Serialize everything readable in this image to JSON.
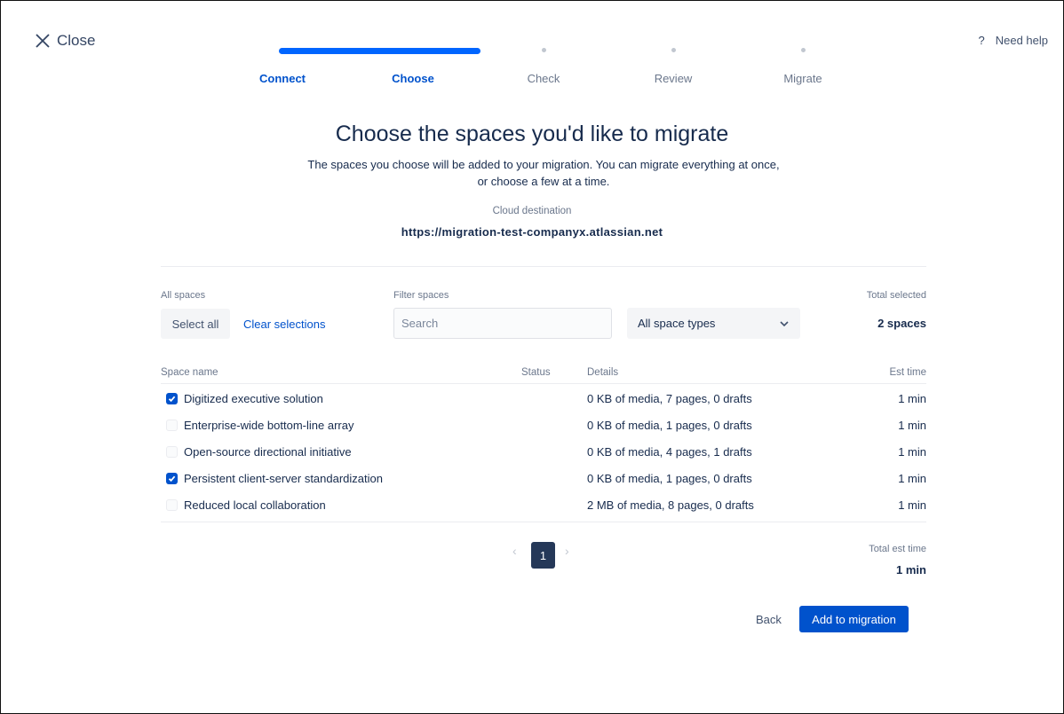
{
  "topbar": {
    "close_label": "Close",
    "help_label": "Need help",
    "help_icon": "?"
  },
  "steps": [
    {
      "label": "Connect",
      "state": "done"
    },
    {
      "label": "Choose",
      "state": "current"
    },
    {
      "label": "Check",
      "state": "todo"
    },
    {
      "label": "Review",
      "state": "todo"
    },
    {
      "label": "Migrate",
      "state": "todo"
    }
  ],
  "header": {
    "title": "Choose the spaces you'd like to migrate",
    "subtitle_line1": "The spaces you choose will be added to your migration. You can migrate everything at once,",
    "subtitle_line2": "or choose a few at a time.",
    "dest_label": "Cloud destination",
    "dest_url": "https://migration-test-companyx.atlassian.net"
  },
  "controls": {
    "all_spaces_label": "All spaces",
    "select_all": "Select all",
    "clear_selections": "Clear selections",
    "filter_label": "Filter spaces",
    "search_placeholder": "Search",
    "space_type_selected": "All space types",
    "total_selected_label": "Total selected",
    "total_selected_value": "2 spaces"
  },
  "table": {
    "headers": {
      "name": "Space name",
      "status": "Status",
      "details": "Details",
      "est": "Est time"
    },
    "rows": [
      {
        "name": "Digitized executive solution",
        "checked": true,
        "details": "0 KB of media, 7 pages, 0 drafts",
        "est": "1 min"
      },
      {
        "name": "Enterprise-wide bottom-line array",
        "checked": false,
        "details": "0 KB of media, 1 pages, 0 drafts",
        "est": "1 min"
      },
      {
        "name": "Open-source directional initiative",
        "checked": false,
        "details": "0 KB of media, 4 pages, 1 drafts",
        "est": "1 min"
      },
      {
        "name": "Persistent client-server standardization",
        "checked": true,
        "details": "0 KB of media, 1 pages, 0 drafts",
        "est": "1 min"
      },
      {
        "name": "Reduced local collaboration",
        "checked": false,
        "details": "2 MB of media, 8 pages, 0 drafts",
        "est": "1 min"
      }
    ]
  },
  "pagination": {
    "current_page": "1",
    "prev_icon": "‹",
    "next_icon": "›"
  },
  "totals": {
    "est_label": "Total est time",
    "est_value": "1 min"
  },
  "footer": {
    "back_label": "Back",
    "add_label": "Add to migration"
  },
  "colors": {
    "primary": "#0052cc",
    "progress": "#0065ff",
    "text": "#172b4d",
    "muted": "#6b778c"
  }
}
